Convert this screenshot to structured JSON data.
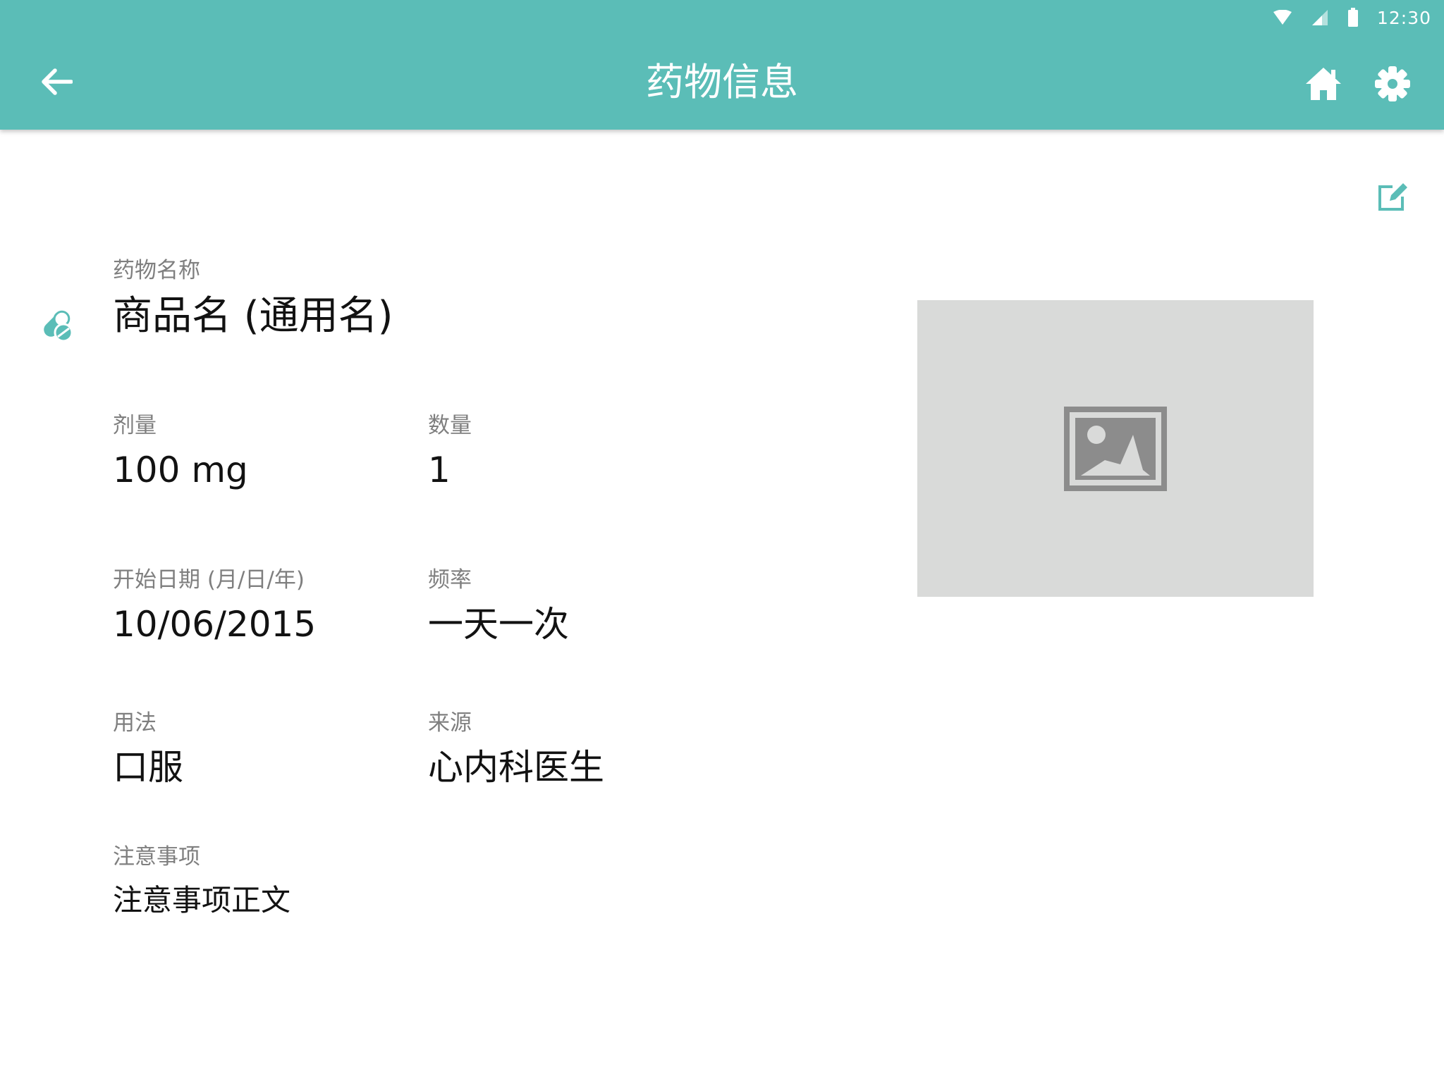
{
  "status_bar": {
    "time": "12:30",
    "icons": [
      "wifi-icon",
      "signal-icon",
      "battery-icon"
    ]
  },
  "appbar": {
    "title": "药物信息",
    "back_icon": "arrow-back-icon",
    "actions": [
      "home-icon",
      "gear-icon"
    ],
    "color": "#5bbdb7"
  },
  "edit_icon": "edit-icon",
  "drug": {
    "name_label": "药物名称",
    "name_value": "商品名 (通用名)",
    "dose_label": "剂量",
    "dose_value": "100 mg",
    "quantity_label": "数量",
    "quantity_value": "1",
    "start_label": "开始日期 (月/日/年)",
    "start_value": "10/06/2015",
    "frequency_label": "频率",
    "frequency_value": "一天一次",
    "usage_label": "用法",
    "usage_value": "口服",
    "source_label": "来源",
    "source_value": "心内科医生",
    "notes_label": "注意事项",
    "notes_value": "注意事项正文"
  },
  "photo_placeholder_icon": "image-placeholder-icon",
  "accent_color": "#5bbdb7"
}
